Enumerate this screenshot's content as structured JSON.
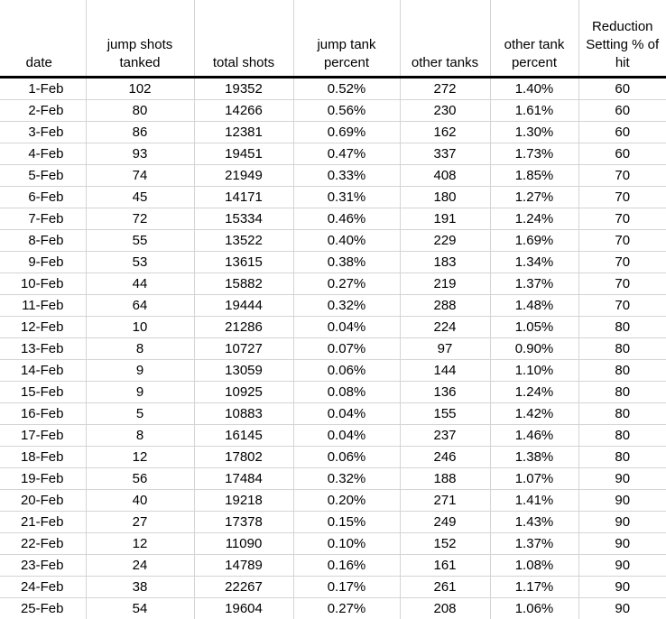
{
  "table": {
    "columns": [
      {
        "key": "date",
        "label": "date"
      },
      {
        "key": "jump_shots",
        "label": "jump shots tanked"
      },
      {
        "key": "total_shots",
        "label": "total shots"
      },
      {
        "key": "jump_tank_pct",
        "label": "jump tank percent"
      },
      {
        "key": "other_tanks",
        "label": "other tanks"
      },
      {
        "key": "other_tank_pct",
        "label": "other tank percent"
      },
      {
        "key": "reduction",
        "label": "Reduction Setting % of hit"
      }
    ],
    "column_labels_lines": [
      [
        "date"
      ],
      [
        "jump shots",
        "tanked"
      ],
      [
        "total shots"
      ],
      [
        "jump tank",
        "percent"
      ],
      [
        "other tanks"
      ],
      [
        "other tank",
        "percent"
      ],
      [
        "Reduction",
        "Setting % of",
        "hit"
      ]
    ],
    "rows": [
      {
        "date": "1-Feb",
        "jump_shots": "102",
        "total_shots": "19352",
        "jump_tank_pct": "0.52%",
        "other_tanks": "272",
        "other_tank_pct": "1.40%",
        "reduction": "60"
      },
      {
        "date": "2-Feb",
        "jump_shots": "80",
        "total_shots": "14266",
        "jump_tank_pct": "0.56%",
        "other_tanks": "230",
        "other_tank_pct": "1.61%",
        "reduction": "60"
      },
      {
        "date": "3-Feb",
        "jump_shots": "86",
        "total_shots": "12381",
        "jump_tank_pct": "0.69%",
        "other_tanks": "162",
        "other_tank_pct": "1.30%",
        "reduction": "60"
      },
      {
        "date": "4-Feb",
        "jump_shots": "93",
        "total_shots": "19451",
        "jump_tank_pct": "0.47%",
        "other_tanks": "337",
        "other_tank_pct": "1.73%",
        "reduction": "60"
      },
      {
        "date": "5-Feb",
        "jump_shots": "74",
        "total_shots": "21949",
        "jump_tank_pct": "0.33%",
        "other_tanks": "408",
        "other_tank_pct": "1.85%",
        "reduction": "70"
      },
      {
        "date": "6-Feb",
        "jump_shots": "45",
        "total_shots": "14171",
        "jump_tank_pct": "0.31%",
        "other_tanks": "180",
        "other_tank_pct": "1.27%",
        "reduction": "70"
      },
      {
        "date": "7-Feb",
        "jump_shots": "72",
        "total_shots": "15334",
        "jump_tank_pct": "0.46%",
        "other_tanks": "191",
        "other_tank_pct": "1.24%",
        "reduction": "70"
      },
      {
        "date": "8-Feb",
        "jump_shots": "55",
        "total_shots": "13522",
        "jump_tank_pct": "0.40%",
        "other_tanks": "229",
        "other_tank_pct": "1.69%",
        "reduction": "70"
      },
      {
        "date": "9-Feb",
        "jump_shots": "53",
        "total_shots": "13615",
        "jump_tank_pct": "0.38%",
        "other_tanks": "183",
        "other_tank_pct": "1.34%",
        "reduction": "70"
      },
      {
        "date": "10-Feb",
        "jump_shots": "44",
        "total_shots": "15882",
        "jump_tank_pct": "0.27%",
        "other_tanks": "219",
        "other_tank_pct": "1.37%",
        "reduction": "70"
      },
      {
        "date": "11-Feb",
        "jump_shots": "64",
        "total_shots": "19444",
        "jump_tank_pct": "0.32%",
        "other_tanks": "288",
        "other_tank_pct": "1.48%",
        "reduction": "70"
      },
      {
        "date": "12-Feb",
        "jump_shots": "10",
        "total_shots": "21286",
        "jump_tank_pct": "0.04%",
        "other_tanks": "224",
        "other_tank_pct": "1.05%",
        "reduction": "80"
      },
      {
        "date": "13-Feb",
        "jump_shots": "8",
        "total_shots": "10727",
        "jump_tank_pct": "0.07%",
        "other_tanks": "97",
        "other_tank_pct": "0.90%",
        "reduction": "80"
      },
      {
        "date": "14-Feb",
        "jump_shots": "9",
        "total_shots": "13059",
        "jump_tank_pct": "0.06%",
        "other_tanks": "144",
        "other_tank_pct": "1.10%",
        "reduction": "80"
      },
      {
        "date": "15-Feb",
        "jump_shots": "9",
        "total_shots": "10925",
        "jump_tank_pct": "0.08%",
        "other_tanks": "136",
        "other_tank_pct": "1.24%",
        "reduction": "80"
      },
      {
        "date": "16-Feb",
        "jump_shots": "5",
        "total_shots": "10883",
        "jump_tank_pct": "0.04%",
        "other_tanks": "155",
        "other_tank_pct": "1.42%",
        "reduction": "80"
      },
      {
        "date": "17-Feb",
        "jump_shots": "8",
        "total_shots": "16145",
        "jump_tank_pct": "0.04%",
        "other_tanks": "237",
        "other_tank_pct": "1.46%",
        "reduction": "80"
      },
      {
        "date": "18-Feb",
        "jump_shots": "12",
        "total_shots": "17802",
        "jump_tank_pct": "0.06%",
        "other_tanks": "246",
        "other_tank_pct": "1.38%",
        "reduction": "80"
      },
      {
        "date": "19-Feb",
        "jump_shots": "56",
        "total_shots": "17484",
        "jump_tank_pct": "0.32%",
        "other_tanks": "188",
        "other_tank_pct": "1.07%",
        "reduction": "90"
      },
      {
        "date": "20-Feb",
        "jump_shots": "40",
        "total_shots": "19218",
        "jump_tank_pct": "0.20%",
        "other_tanks": "271",
        "other_tank_pct": "1.41%",
        "reduction": "90"
      },
      {
        "date": "21-Feb",
        "jump_shots": "27",
        "total_shots": "17378",
        "jump_tank_pct": "0.15%",
        "other_tanks": "249",
        "other_tank_pct": "1.43%",
        "reduction": "90"
      },
      {
        "date": "22-Feb",
        "jump_shots": "12",
        "total_shots": "11090",
        "jump_tank_pct": "0.10%",
        "other_tanks": "152",
        "other_tank_pct": "1.37%",
        "reduction": "90"
      },
      {
        "date": "23-Feb",
        "jump_shots": "24",
        "total_shots": "14789",
        "jump_tank_pct": "0.16%",
        "other_tanks": "161",
        "other_tank_pct": "1.08%",
        "reduction": "90"
      },
      {
        "date": "24-Feb",
        "jump_shots": "38",
        "total_shots": "22267",
        "jump_tank_pct": "0.17%",
        "other_tanks": "261",
        "other_tank_pct": "1.17%",
        "reduction": "90"
      },
      {
        "date": "25-Feb",
        "jump_shots": "54",
        "total_shots": "19604",
        "jump_tank_pct": "0.27%",
        "other_tanks": "208",
        "other_tank_pct": "1.06%",
        "reduction": "90"
      }
    ]
  },
  "style": {
    "grid_line_color": "#d4d4d4",
    "header_rule_color": "#000000",
    "text_color": "#000000",
    "background": "#ffffff"
  }
}
